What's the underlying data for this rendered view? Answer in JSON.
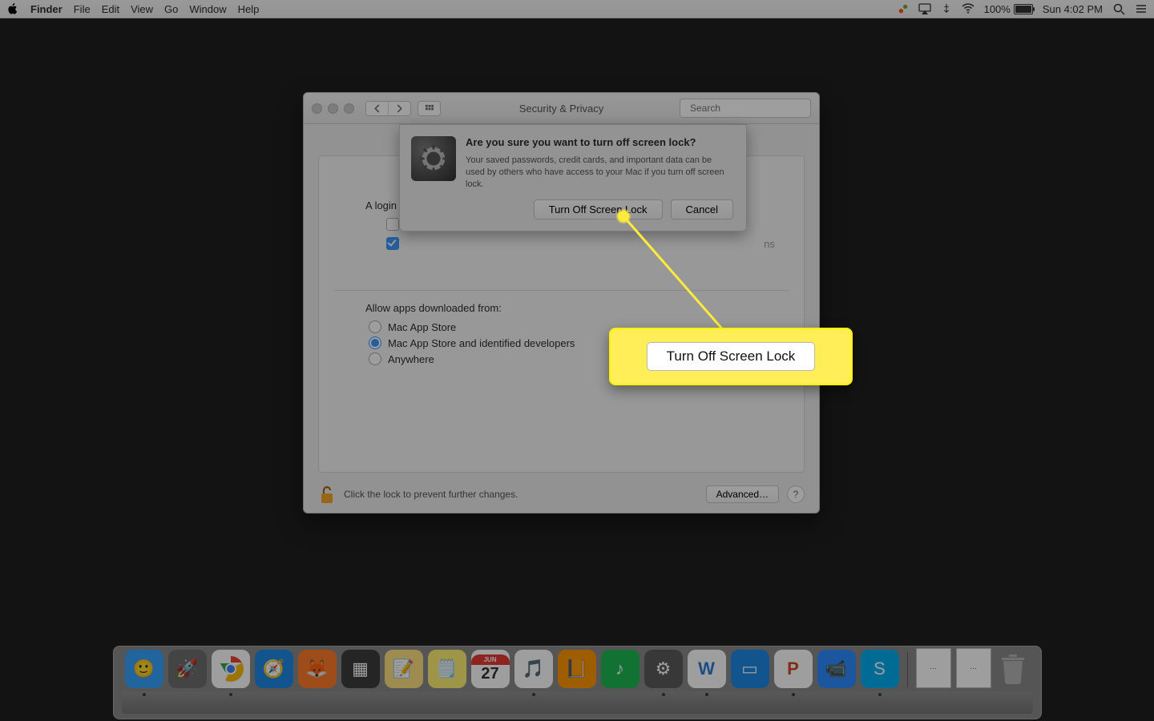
{
  "menubar": {
    "app": "Finder",
    "items": [
      "File",
      "Edit",
      "View",
      "Go",
      "Window",
      "Help"
    ],
    "battery_percent": "100%",
    "clock": "Sun 4:02 PM"
  },
  "window": {
    "title": "Security & Privacy",
    "search_placeholder": "Search",
    "login_label_visible": "A login",
    "sleep_suffix_visible": "ns",
    "allow_label": "Allow apps downloaded from:",
    "download_options": [
      {
        "label": "Mac App Store",
        "checked": false
      },
      {
        "label": "Mac App Store and identified developers",
        "checked": true
      },
      {
        "label": "Anywhere",
        "checked": false
      }
    ],
    "lock_message": "Click the lock to prevent further changes.",
    "advanced_btn": "Advanced…",
    "help": "?"
  },
  "sheet": {
    "question": "Are you sure you want to turn off screen lock?",
    "detail": "Your saved passwords, credit cards, and important data can be used by others who have access to your Mac if you turn off screen lock.",
    "primary_btn": "Turn Off Screen Lock",
    "cancel_btn": "Cancel"
  },
  "callout": {
    "label": "Turn Off Screen Lock"
  },
  "dock": {
    "apps": [
      {
        "name": "finder",
        "bg": "#35a3ff",
        "glyph": "🙂",
        "running": true
      },
      {
        "name": "launchpad",
        "bg": "#6e6e6e",
        "glyph": "🚀",
        "running": false
      },
      {
        "name": "chrome",
        "bg": "#ffffff",
        "glyph": "◉",
        "running": true
      },
      {
        "name": "safari",
        "bg": "#1e88e5",
        "glyph": "🧭",
        "running": false
      },
      {
        "name": "firefox",
        "bg": "#ff7b29",
        "glyph": "🦊",
        "running": false
      },
      {
        "name": "mission-control",
        "bg": "#3d3d3d",
        "glyph": "▦",
        "running": false
      },
      {
        "name": "notes",
        "bg": "#ffe082",
        "glyph": "📝",
        "running": false
      },
      {
        "name": "stickies",
        "bg": "#fff176",
        "glyph": "🗒️",
        "running": false
      },
      {
        "name": "calendar",
        "bg": "#ffffff",
        "glyph": "27",
        "running": false
      },
      {
        "name": "music",
        "bg": "#ffffff",
        "glyph": "🎵",
        "running": true
      },
      {
        "name": "books",
        "bg": "#ff9800",
        "glyph": "📙",
        "running": false
      },
      {
        "name": "spotify",
        "bg": "#1db954",
        "glyph": "♪",
        "running": false
      },
      {
        "name": "system-preferences",
        "bg": "#5b5b5b",
        "glyph": "⚙︎",
        "running": true
      },
      {
        "name": "word",
        "bg": "#ffffff",
        "glyph": "W",
        "running": true
      },
      {
        "name": "keynote",
        "bg": "#1e88e5",
        "glyph": "▭",
        "running": false
      },
      {
        "name": "powerpoint",
        "bg": "#ffffff",
        "glyph": "P",
        "running": true
      },
      {
        "name": "zoom",
        "bg": "#2d8cff",
        "glyph": "📹",
        "running": false
      },
      {
        "name": "skype",
        "bg": "#00aff0",
        "glyph": "S",
        "running": true
      }
    ],
    "cal_month": "JUN"
  }
}
